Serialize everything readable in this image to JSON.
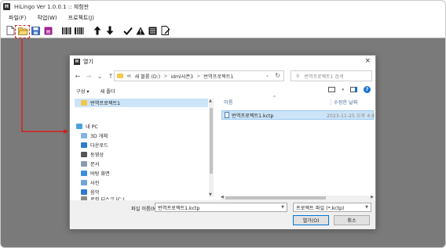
{
  "app": {
    "logo_letter": "H",
    "title": "HiLingo Ver 1.0.0.1 :: 체험판",
    "menu": [
      {
        "label": "파일(F)"
      },
      {
        "label": "작업(W)"
      },
      {
        "label": "프로젝트(J)"
      }
    ],
    "toolbar_icons": [
      "new-file-icon",
      "open-folder-icon",
      "save-icon",
      "project-icon",
      "barcode-icon",
      "barcode-alt-icon",
      "up-arrow-icon",
      "down-arrow-icon",
      "check-icon",
      "warning-icon",
      "list-icon",
      "edit-doc-icon"
    ],
    "highlight_color": "#d62020"
  },
  "dialog": {
    "logo_letter": "H",
    "title": "열기",
    "close": "×",
    "nav": {
      "back": "←",
      "forward": "→",
      "dropdown": "⌄",
      "up": "↑"
    },
    "address": {
      "crumbs": [
        "≪",
        "새 볼륨 (D:)",
        ">",
        "idml샤픈3",
        ">",
        "번역프로젝트1"
      ],
      "refresh": "↻"
    },
    "search": {
      "placeholder": "번역프로젝트1 검색"
    },
    "commands": {
      "organize": "구성 ▾",
      "new_folder": "새 폴더",
      "help": "?"
    },
    "nav_items": [
      {
        "label": "번역프로젝트1",
        "icon": "folder-icon",
        "color": "#f3c74d",
        "selected": true
      },
      {
        "label": "내 PC",
        "icon": "pc-icon",
        "color": "#4aa3df",
        "selected": false
      },
      {
        "label": "3D 개체",
        "icon": "3d-objects-icon",
        "color": "#7fb4e3",
        "selected": false
      },
      {
        "label": "다운로드",
        "icon": "download-icon",
        "color": "#2b7bd1",
        "selected": false
      },
      {
        "label": "동영상",
        "icon": "video-icon",
        "color": "#555555",
        "selected": false
      },
      {
        "label": "문서",
        "icon": "documents-icon",
        "color": "#8a9bb0",
        "selected": false
      },
      {
        "label": "바탕 화면",
        "icon": "desktop-icon",
        "color": "#3b8fd9",
        "selected": false
      },
      {
        "label": "사진",
        "icon": "pictures-icon",
        "color": "#6fa6d6",
        "selected": false
      },
      {
        "label": "음악",
        "icon": "music-icon",
        "color": "#2b7bd1",
        "selected": false
      },
      {
        "label": "로컬 디스크 (C:)",
        "icon": "disk-icon",
        "color": "#8a8a8a",
        "selected": false
      }
    ],
    "columns": {
      "name": "이름",
      "date": "수정한 날짜",
      "sort_indicator": "^"
    },
    "files": [
      {
        "name": "번역프로젝트1.kctp",
        "date": "2023-11-25 오후 4:0"
      }
    ],
    "filename_label": "파일 이름(N):",
    "filename_value": "번역프로젝트1.kctp",
    "filetype_value": "프로젝트 파일 (*.kctp)",
    "open_label": "열기(O)",
    "cancel_label": "취소"
  }
}
